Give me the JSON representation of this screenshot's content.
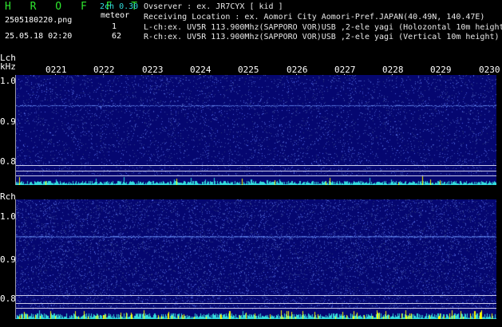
{
  "header": {
    "app_title": "H R O F F T",
    "mode": "2ch 0.30",
    "filename": "2505180220.png",
    "datetime": "25.05.18 02:20",
    "meteor_label": "meteor",
    "lch_count": "1",
    "rch_count": "62",
    "observer": "Ovserver              : ex. JR7CYX [ kid ]",
    "location": "Receiving Location : ex. Aomori City Aomori-Pref.JAPAN(40.49N, 140.47E)",
    "lch_info": "L-ch:ex. UV5R 113.900Mhz(SAPPORO VOR)USB ,2-ele yagi (Holozontal 10m height",
    "rch_info": "R-ch:ex. UV5R 113.900Mhz(SAPPORO VOR)USB ,2-ele yagi (Vertical 10m height)"
  },
  "lch": {
    "label": "Lch",
    "unit": "kHz",
    "y_labels": [
      "1.0",
      "0.9",
      "0.8"
    ]
  },
  "rch": {
    "label": "Rch",
    "y_labels": [
      "1.0",
      "0.9",
      "0.8"
    ]
  },
  "time_labels": [
    "0221",
    "0222",
    "0223",
    "0224",
    "0225",
    "0226",
    "0227",
    "0228",
    "0229",
    "0230"
  ],
  "colors": {
    "panel": "#050770",
    "trace": "#33dddd",
    "meteor": "#ffff00",
    "grid": "#c8c8e8"
  }
}
